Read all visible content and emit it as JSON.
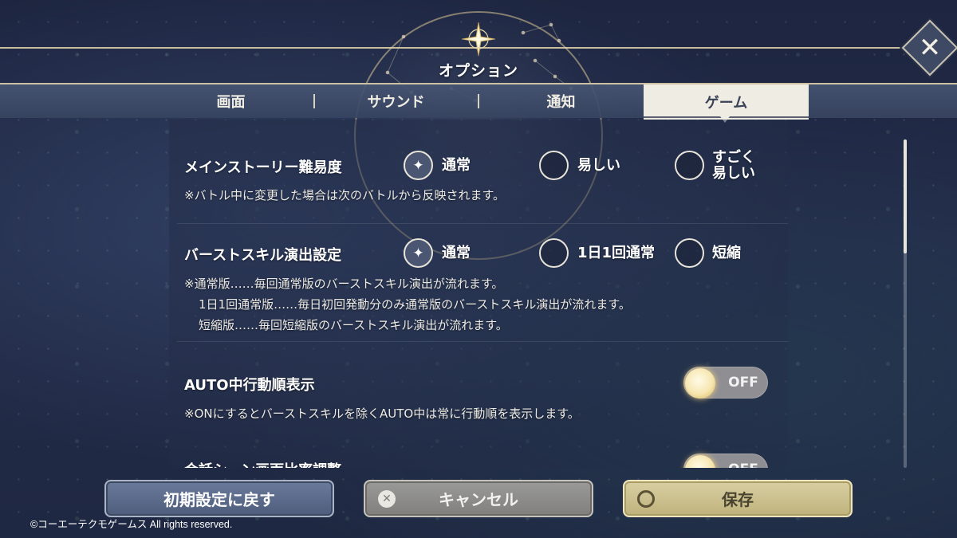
{
  "header": {
    "title": "オプション",
    "close_icon": "close-icon"
  },
  "tabs": [
    {
      "label": "画面",
      "active": false
    },
    {
      "label": "サウンド",
      "active": false
    },
    {
      "label": "通知",
      "active": false
    },
    {
      "label": "ゲーム",
      "active": true
    }
  ],
  "settings": {
    "story_difficulty": {
      "label": "メインストーリー難易度",
      "options": [
        "通常",
        "易しい",
        "すごく\n易しい"
      ],
      "selected": 0,
      "note": "※バトル中に変更した場合は次のバトルから反映されます。"
    },
    "burst_skill": {
      "label": "バーストスキル演出設定",
      "options": [
        "通常",
        "1日1回通常",
        "短縮"
      ],
      "selected": 0,
      "notes": [
        "※通常版……毎回通常版のバーストスキル演出が流れます。",
        "1日1回通常版……毎日初回発動分のみ通常版のバーストスキル演出が流れます。",
        "短縮版……毎回短縮版のバーストスキル演出が流れます。"
      ]
    },
    "auto_order": {
      "label": "AUTO中行動順表示",
      "toggle": "OFF",
      "note": "※ONにするとバーストスキルを除くAUTO中は常に行動順を表示します。"
    },
    "dialogue_partial": {
      "label": "会話シーン画面比率調整",
      "toggle": "OFF"
    }
  },
  "buttons": {
    "reset": "初期設定に戻す",
    "cancel": "キャンセル",
    "save": "保存"
  },
  "footer": {
    "copyright": "©コーエーテクモゲームス All rights reserved."
  },
  "colors": {
    "active_tab_bg": "#efece3",
    "gold_line": "#e6d7af",
    "save_button": "#d8cfa2",
    "reset_button": "#5f6e8f",
    "cancel_button": "#8f8e8b"
  }
}
